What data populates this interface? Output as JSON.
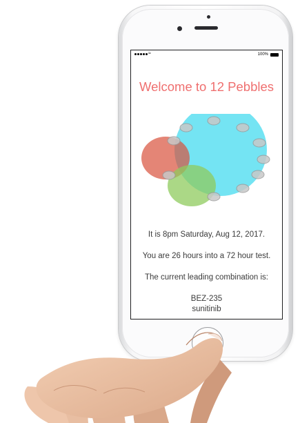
{
  "status_bar": {
    "signal_icon": "signal-dots-icon",
    "wifi_icon": "wifi-icon",
    "battery_percent": "100%",
    "battery_icon": "battery-icon"
  },
  "app": {
    "title": "Welcome to 12 Pebbles",
    "logo_icon": "pebbles-logo-icon",
    "time_line": "It is 8pm Saturday, Aug 12, 2017.",
    "progress_line": "You are 26 hours into a 72 hour test.",
    "leading_label": "The current leading combination is:",
    "combination": [
      "BEZ-235",
      "sunitinib"
    ]
  },
  "colors": {
    "title": "#ef6f6f",
    "big_circle": "#45dbef",
    "red_circle": "#d9513c",
    "green_circle": "#8fcb5e",
    "pebble": "#c8c8c8"
  }
}
